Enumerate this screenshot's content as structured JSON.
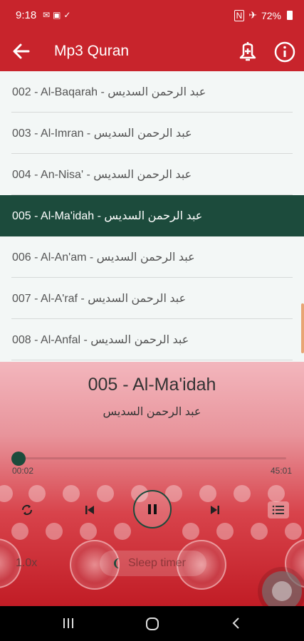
{
  "status_bar": {
    "time": "9:18",
    "icons": [
      "mail-icon",
      "image-icon",
      "check-icon"
    ],
    "right_icons": [
      "nfc-icon",
      "airplane-icon"
    ],
    "battery": "72%"
  },
  "app_bar": {
    "title": "Mp3 Quran",
    "accent": "#c8242c"
  },
  "list": {
    "items": [
      {
        "text": "002 - Al-Baqarah - عبد الرحمن السديس",
        "active": false
      },
      {
        "text": "003 - Al-Imran - عبد الرحمن السديس",
        "active": false
      },
      {
        "text": "004 - An-Nisa' - عبد الرحمن السديس",
        "active": false
      },
      {
        "text": "005 - Al-Ma'idah - عبد الرحمن السديس",
        "active": true
      },
      {
        "text": "006 - Al-An'am - عبد الرحمن السديس",
        "active": false
      },
      {
        "text": "007 - Al-A'raf - عبد الرحمن السديس",
        "active": false
      },
      {
        "text": "008 - Al-Anfal - عبد الرحمن السديس",
        "active": false
      }
    ],
    "active_color": "#1c4b3c"
  },
  "player": {
    "title": "005 - Al-Ma'idah",
    "reciter": "عبد الرحمن السديس",
    "elapsed": "00:02",
    "total": "45:01",
    "progress_fraction": 0.0007,
    "speed": "1.0x",
    "sleep_timer_label": "Sleep timer",
    "controls": [
      "repeat-icon",
      "previous-icon",
      "pause-icon",
      "next-icon",
      "playlist-icon"
    ]
  }
}
